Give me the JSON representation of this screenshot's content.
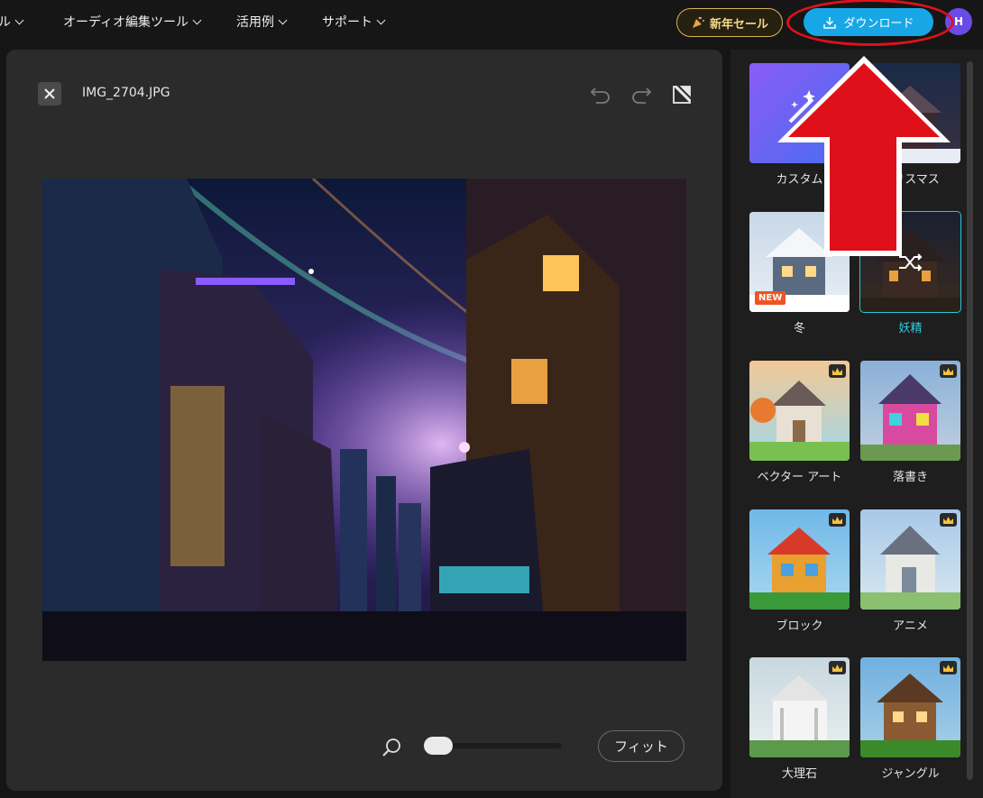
{
  "nav": {
    "item_tool_partial": "ル",
    "item_audio": "オーディオ編集ツール",
    "item_examples": "活用例",
    "item_support": "サポート",
    "sale_label": "新年セール",
    "download_label": "ダウンロード",
    "avatar_initial": "H"
  },
  "editor": {
    "filename": "IMG_2704.JPG",
    "fit_label": "フィット",
    "zoom_level": 0.0
  },
  "styles": {
    "items": [
      {
        "label": "カスタム",
        "state": "normal"
      },
      {
        "label": "クリスマス",
        "state": "normal"
      },
      {
        "label": "冬",
        "state": "normal",
        "badge": "NEW"
      },
      {
        "label": "妖精",
        "state": "selected"
      },
      {
        "label": "ベクター アート",
        "state": "premium"
      },
      {
        "label": "落書き",
        "state": "premium"
      },
      {
        "label": "ブロック",
        "state": "premium"
      },
      {
        "label": "アニメ",
        "state": "premium"
      },
      {
        "label": "大理石",
        "state": "premium"
      },
      {
        "label": "ジャングル",
        "state": "premium"
      }
    ]
  },
  "colors": {
    "accent_cyan": "#2ccfdf",
    "download_blue": "#17a7e6",
    "annotation_red": "#e0101a",
    "new_badge": "#ef5522"
  },
  "icons": [
    "chevron-down-icon",
    "party-popper-icon",
    "download-icon",
    "close-icon",
    "undo-icon",
    "redo-icon",
    "compare-icon",
    "zoom-icon",
    "shuffle-icon",
    "crown-icon",
    "magic-wand-icon"
  ]
}
